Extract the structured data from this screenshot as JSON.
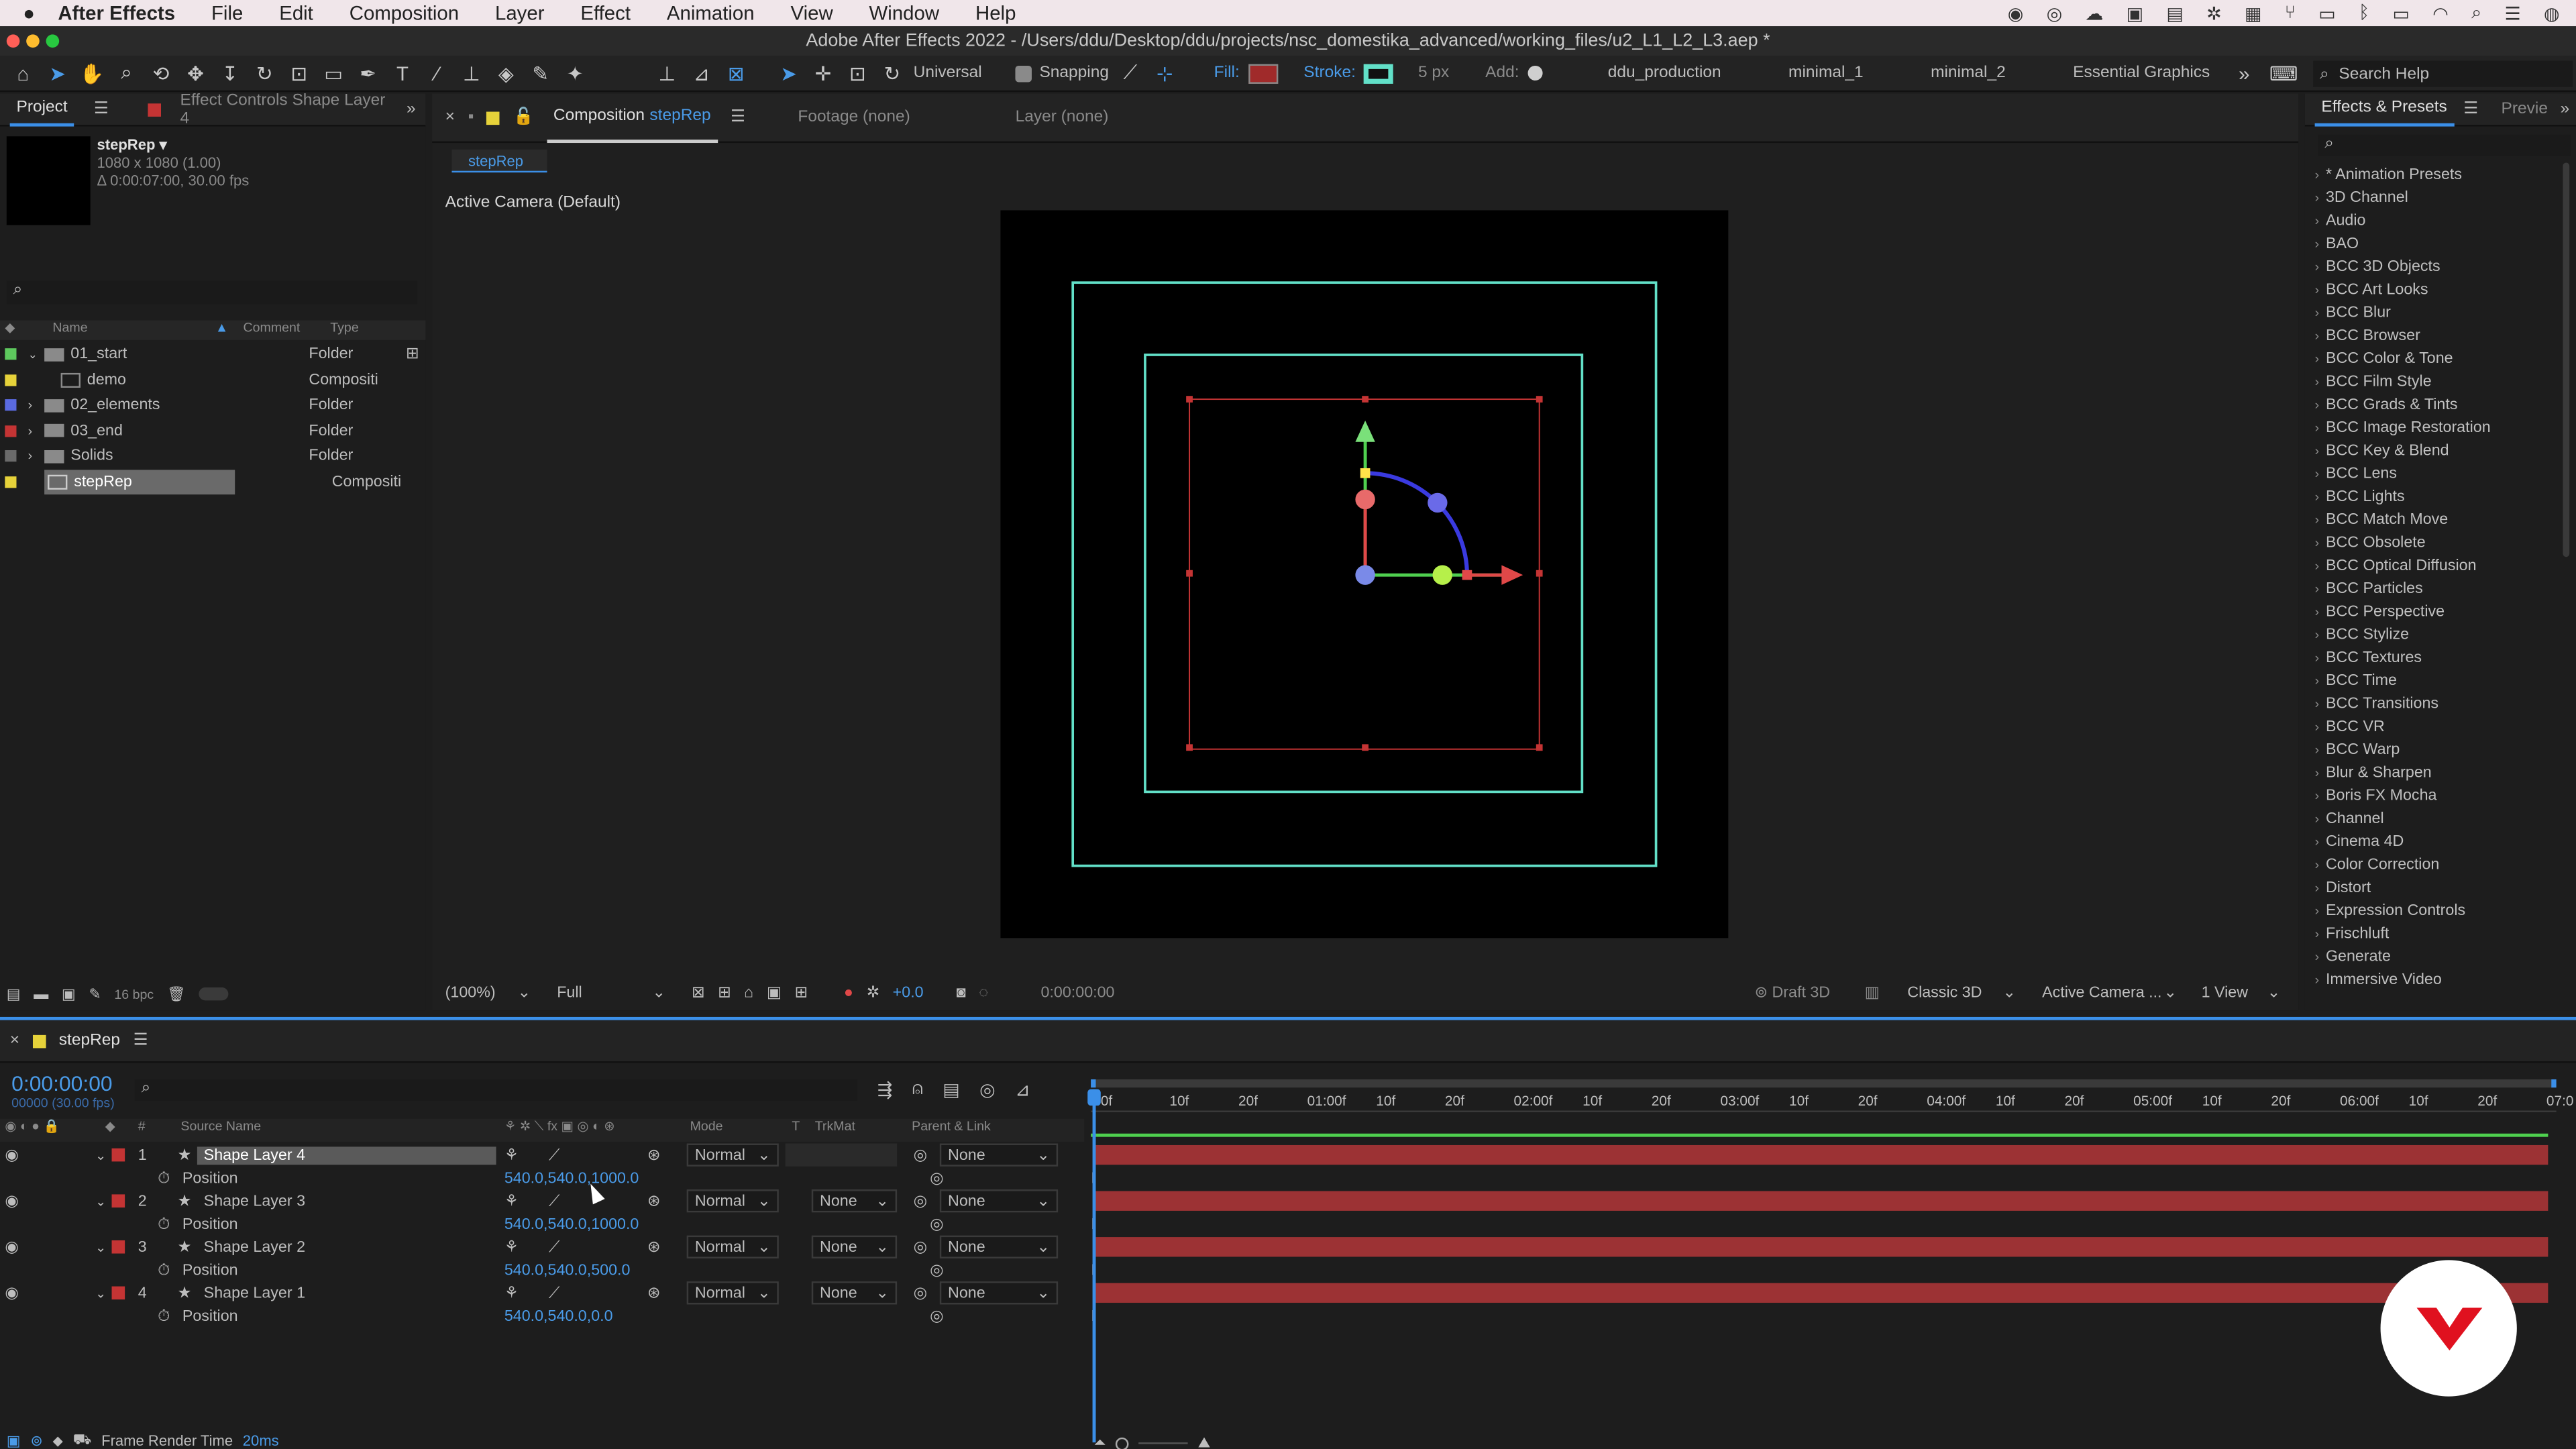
{
  "menubar": {
    "app": "After Effects",
    "items": [
      "File",
      "Edit",
      "Composition",
      "Layer",
      "Effect",
      "Animation",
      "View",
      "Window",
      "Help"
    ]
  },
  "titlebar": {
    "title": "Adobe After Effects 2022 - /Users/ddu/Desktop/ddu/projects/nsc_domestika_advanced/working_files/u2_L1_L2_L3.aep *"
  },
  "toolbar": {
    "universal": "Universal",
    "snapping": "Snapping",
    "fill": "Fill:",
    "stroke": "Stroke:",
    "stroke_width": "5 px",
    "add": "Add:",
    "workspaces": [
      "ddu_production",
      "minimal_1",
      "minimal_2",
      "Essential Graphics"
    ],
    "search_placeholder": "Search Help",
    "colors": {
      "fill": "#a02a2a",
      "stroke": "#62e0c8"
    }
  },
  "project": {
    "tabs": {
      "project": "Project",
      "effect_controls": "Effect Controls Shape Layer 4"
    },
    "thumb": {
      "name": "stepRep ▾",
      "size": "1080 x 1080 (1.00)",
      "duration": "Δ 0:00:07:00, 30.00 fps"
    },
    "columns": {
      "name": "Name",
      "comment": "Comment",
      "type": "Type"
    },
    "items": [
      {
        "name": "01_start",
        "type": "Folder",
        "color": "#5ec95e"
      },
      {
        "name": "demo",
        "type": "Compositi",
        "color": "#e6d23a"
      },
      {
        "name": "02_elements",
        "type": "Folder",
        "color": "#5a6ae0"
      },
      {
        "name": "03_end",
        "type": "Folder",
        "color": "#c43434"
      },
      {
        "name": "Solids",
        "type": "Folder",
        "color": "#6a6a6a"
      },
      {
        "name": "stepRep",
        "type": "Compositi",
        "color": "#e6d23a"
      }
    ],
    "bpc": "16 bpc"
  },
  "viewer": {
    "tabs": {
      "composition": "Composition",
      "comp_name": "stepRep",
      "footage": "Footage (none)",
      "layer": "Layer (none)"
    },
    "breadcrumb": "stepRep",
    "camera": "Active Camera (Default)",
    "zoom": "(100%)",
    "resolution": "Full",
    "exposure": "+0.0",
    "timecode": "0:00:00:00",
    "draft": "Draft 3D",
    "renderer": "Classic 3D",
    "camera_menu": "Active Camera ...",
    "views": "1 View"
  },
  "effects": {
    "tabs": {
      "effects": "Effects & Presets",
      "preview": "Previe"
    },
    "items": [
      "* Animation Presets",
      "3D Channel",
      "Audio",
      "BAO",
      "BCC 3D Objects",
      "BCC Art Looks",
      "BCC Blur",
      "BCC Browser",
      "BCC Color & Tone",
      "BCC Film Style",
      "BCC Grads & Tints",
      "BCC Image Restoration",
      "BCC Key & Blend",
      "BCC Lens",
      "BCC Lights",
      "BCC Match Move",
      "BCC Obsolete",
      "BCC Optical Diffusion",
      "BCC Particles",
      "BCC Perspective",
      "BCC Stylize",
      "BCC Textures",
      "BCC Time",
      "BCC Transitions",
      "BCC VR",
      "BCC Warp",
      "Blur & Sharpen",
      "Boris FX Mocha",
      "Channel",
      "Cinema 4D",
      "Color Correction",
      "Distort",
      "Expression Controls",
      "Frischluft",
      "Generate",
      "Immersive Video"
    ]
  },
  "timeline": {
    "tab": "stepRep",
    "timecode": "0:00:00:00",
    "fps": "00000 (30.00 fps)",
    "columns": {
      "source": "Source Name",
      "mode": "Mode",
      "t": "T",
      "trkmat": "TrkMat",
      "parent": "Parent & Link"
    },
    "ruler": [
      "0f",
      "10f",
      "20f",
      "01:00f",
      "10f",
      "20f",
      "02:00f",
      "10f",
      "20f",
      "03:00f",
      "10f",
      "20f",
      "04:00f",
      "10f",
      "20f",
      "05:00f",
      "10f",
      "20f",
      "06:00f",
      "10f",
      "20f",
      "07:0"
    ],
    "layers": [
      {
        "num": "1",
        "name": "Shape Layer 4",
        "mode": "Normal",
        "trkmat": "",
        "parent": "None",
        "prop": "Position",
        "value": "540.0,540.0,1000.0",
        "selected": true
      },
      {
        "num": "2",
        "name": "Shape Layer 3",
        "mode": "Normal",
        "trkmat": "None",
        "parent": "None",
        "prop": "Position",
        "value": "540.0,540.0,1000.0",
        "selected": false
      },
      {
        "num": "3",
        "name": "Shape Layer 2",
        "mode": "Normal",
        "trkmat": "None",
        "parent": "None",
        "prop": "Position",
        "value": "540.0,540.0,500.0",
        "selected": false
      },
      {
        "num": "4",
        "name": "Shape Layer 1",
        "mode": "Normal",
        "trkmat": "None",
        "parent": "None",
        "prop": "Position",
        "value": "540.0,540.0,0.0",
        "selected": false
      }
    ],
    "footer": {
      "label": "Frame Render Time",
      "value": "20ms"
    }
  }
}
